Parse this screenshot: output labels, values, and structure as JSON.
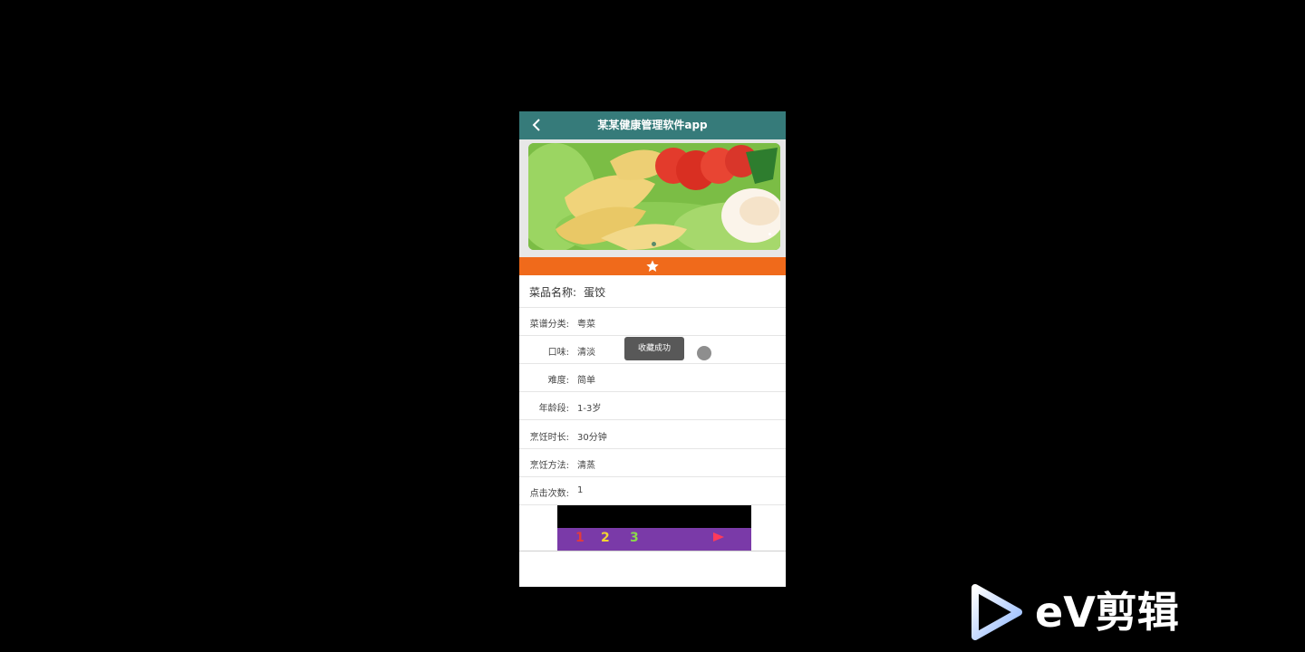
{
  "app": {
    "title": "某某健康管理软件app",
    "back_icon": "chevron-left-icon",
    "header_color": "#367b7a"
  },
  "banner": {
    "image_description": "dumplings with lettuce and tomato slices",
    "slides": 2,
    "active_slide": 1
  },
  "favorite": {
    "icon": "star-icon",
    "bar_color": "#f06a1b"
  },
  "dish": {
    "name_label": "菜品名称:",
    "name_value": "蛋饺",
    "fields": [
      {
        "label": "菜谱分类:",
        "value": "粤菜"
      },
      {
        "label": "口味:",
        "value": "清淡"
      },
      {
        "label": "难度:",
        "value": "简单"
      },
      {
        "label": "年龄段:",
        "value": "1-3岁"
      },
      {
        "label": "烹饪时长:",
        "value": "30分钟"
      },
      {
        "label": "烹饪方法:",
        "value": "清蒸"
      },
      {
        "label": "点击次数:",
        "value": "1"
      }
    ]
  },
  "video": {
    "numbers": [
      "1",
      "2",
      "3"
    ]
  },
  "toast": {
    "message": "收藏成功"
  },
  "watermark": {
    "text": "eV剪辑",
    "icon": "play-logo-icon"
  }
}
